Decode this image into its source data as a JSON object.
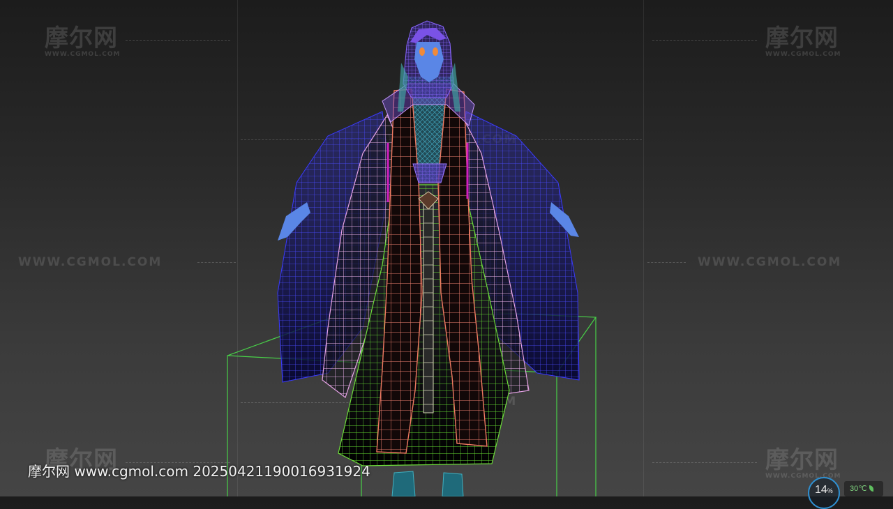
{
  "watermark": {
    "logo_text": "摩尔网",
    "logo_sub": "WWW.CGMOL.COM",
    "url_text": "WWW.CGMOL.COM"
  },
  "caption": "摩尔网 www.cgmol.com 20250421190016931924",
  "hud": {
    "percent_value": "14",
    "percent_unit": "%",
    "temperature": "30℃"
  },
  "colors": {
    "bounding_box": "#48d048",
    "sleeve_outer": "#3a3aff",
    "sleeve_inner": "#e6a3e6",
    "robe_panel": "#f07a62",
    "skirt": "#6ddc3a",
    "skin": "#5a86e6",
    "hair": "#7a52e6",
    "eyes": "#f08a3a"
  }
}
